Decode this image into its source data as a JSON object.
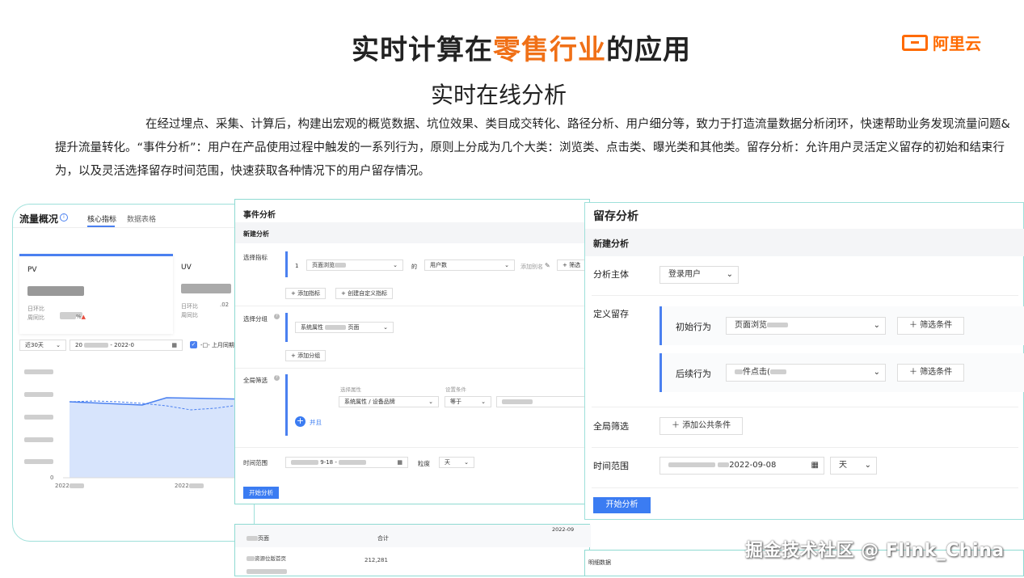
{
  "slide": {
    "title_pre": "实时计算在",
    "title_highlight": "零售行业",
    "title_post": "的应用",
    "subtitle": "实时在线分析",
    "description": "在经过埋点、采集、计算后，构建出宏观的概览数据、坑位效果、类目成交转化、路径分析、用户细分等，致力于打造流量数据分析闭环，快速帮助业务发现流量问题&提升流量转化。“事件分析”：用户在产品使用过程中触发的一系列行为，原则上分成为几个大类：浏览类、点击类、曝光类和其他类。留存分析：允许用户灵活定义留存的初始和结束行为，以及灵活选择留存时间范围，快速获取各种情况下的用户留存情况。",
    "logo_text": "阿里云",
    "watermark": "掘金技术社区 @ Flink_China",
    "accent_color": "#f07017"
  },
  "traffic": {
    "title": "流量概况",
    "tab_core": "核心指标",
    "tab_table": "数据表格",
    "pv_label": "PV",
    "uv_label": "UV",
    "mom_label": "日环比",
    "wow_label": "周同比",
    "pct": "%",
    "pct_uv": ".02",
    "range_select": "近30天",
    "date_start": "20",
    "date_sep": "-",
    "date_end": "2022-0",
    "compare_label": "-□- 上月同期",
    "zero": "0",
    "x_tick_1": "2022",
    "x_tick_2": "2022"
  },
  "event": {
    "title": "事件分析",
    "new": "新建分析",
    "metric_label": "选择指标",
    "metric_index": "1",
    "metric_event": "页面浏览",
    "metric_of": "的",
    "metric_field": "用户数",
    "alias_placeholder": "添加别名",
    "filter_btn": "+ 筛选",
    "add_metric": "+ 添加指标",
    "custom_metric": "+ 创建自定义指标",
    "group_label": "选择分组",
    "group_value": "系统属性",
    "group_suffix": "页面",
    "add_group": "+ 添加分组",
    "global_label": "全局筛选",
    "attr_header": "选择属性",
    "cond_header": "设置条件",
    "attr_value": "系统属性 / 设备品牌",
    "cond_value": "等于",
    "and_label": "并且",
    "time_label": "时间范围",
    "time_mid": "9-18",
    "granularity_label": "粒度",
    "granularity_value": "天",
    "start_btn": "开始分析"
  },
  "retention": {
    "title": "留存分析",
    "new": "新建分析",
    "subject_label": "分析主体",
    "subject_value": "登录用户",
    "define_label": "定义留存",
    "initial_label": "初始行为",
    "initial_value": "页面浏览",
    "filter_btn": "筛选条件",
    "followup_label": "后续行为",
    "followup_value": "件点击(",
    "global_label": "全局筛选",
    "add_common": "添加公共条件",
    "time_label": "时间范围",
    "date_end": "2022-09-08",
    "unit_value": "天",
    "start_btn": "开始分析"
  },
  "table": {
    "page_header": "页面",
    "total_header": "合计",
    "date": "2022-09",
    "row_name": "资源位版首页",
    "row_value": "212,281",
    "detail_label": "明细数据"
  }
}
